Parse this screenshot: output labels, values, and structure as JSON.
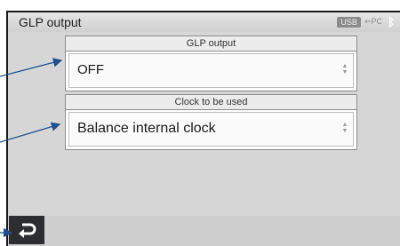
{
  "window": {
    "title": "GLP output"
  },
  "status": {
    "usb_label": "USB",
    "pc_label": "PC"
  },
  "glp_group": {
    "label": "GLP output",
    "value": "OFF"
  },
  "clock_group": {
    "label": "Clock to be used",
    "value": "Balance internal clock"
  },
  "colors": {
    "callout_arrow": "#1f4e8c",
    "back_button": "#2b2d30",
    "panel_bg": "#d6d6d6"
  },
  "icons": {
    "back": "return-arrow-icon",
    "bluetooth": "bluetooth-icon",
    "usb": "usb-icon",
    "pc": "pc-connection-icon"
  }
}
